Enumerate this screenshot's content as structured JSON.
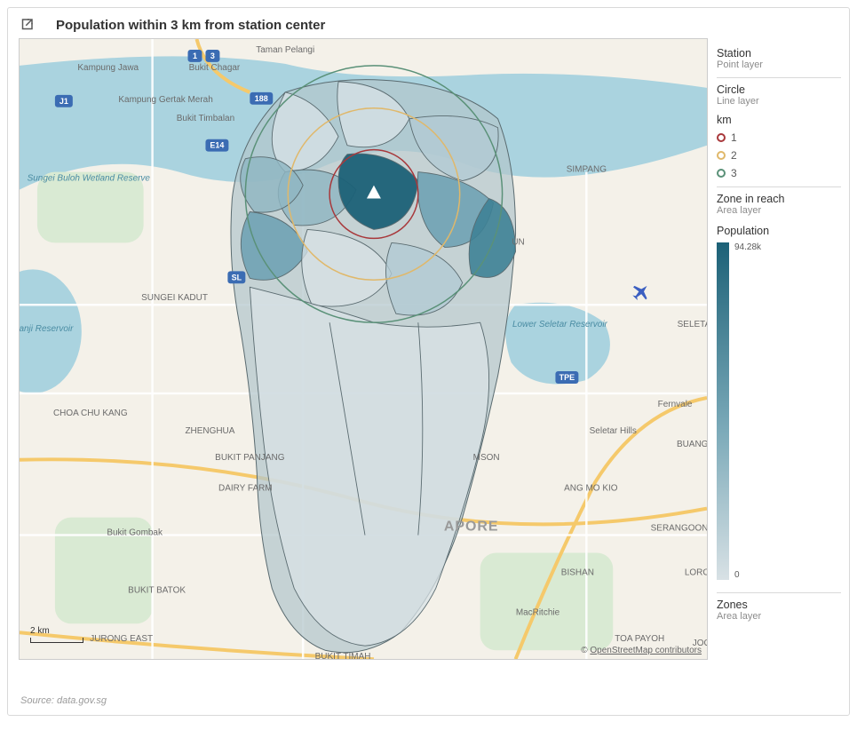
{
  "title": "Population within 3 km from station center",
  "source": "Source: data.gov.sg",
  "map": {
    "scale_label": "2 km",
    "attribution_prefix": "©",
    "attribution_link": "OpenStreetMap contributors",
    "center_label": "APORE",
    "labels": {
      "taman_pelangi": "Taman Pelangi",
      "kampung_jawa": "Kampung Jawa",
      "bukit_chagar": "Bukit Chagar",
      "kampung_gertak_merah": "Kampung Gertak Merah",
      "bukit_timbalan": "Bukit Timbalan",
      "sungei_buloh": "Sungei Buloh Wetland Reserve",
      "kranji_reservoir": "Kranji Reservoir",
      "sungei_kadut": "SUNGEI KADUT",
      "choa_chu_kang": "CHOA CHU KANG",
      "zhenghua": "ZHENGHUA",
      "bukit_panjang": "BUKIT PANJANG",
      "dairy_farm": "DAIRY FARM",
      "bukit_gombak": "Bukit Gombak",
      "bukit_batok": "BUKIT BATOK",
      "jurong_east": "JURONG EAST",
      "bukit_timah": "BUKIT TIMAH",
      "simpang": "SIMPANG",
      "lower_seletar": "Lower Seletar Reservoir",
      "seletar": "SELETAR",
      "fernvale": "Fernvale",
      "seletar_hills": "Seletar Hills",
      "buang": "BUANGK",
      "ang_mo_kio": "ANG MO KIO",
      "serangoon": "SERANGOON",
      "bishan": "BISHAN",
      "loro": "LORO",
      "joo": "JOO",
      "toa_payoh": "TOA PAYOH",
      "macritchie": "MacRitchie",
      "un": "UN",
      "mson": "MSON"
    },
    "highway": {
      "j1": "J1",
      "one": "1",
      "three": "3",
      "one88": "188",
      "e14": "E14",
      "sl": "SL",
      "tpe": "TPE"
    }
  },
  "legend": {
    "station": {
      "title": "Station",
      "sub": "Point layer"
    },
    "circle": {
      "title": "Circle",
      "sub": "Line layer"
    },
    "km_title": "km",
    "km": [
      {
        "label": "1",
        "color": "#a8383b"
      },
      {
        "label": "2",
        "color": "#e0b86a"
      },
      {
        "label": "3",
        "color": "#5a9178"
      }
    ],
    "zone_reach": {
      "title": "Zone in reach",
      "sub": "Area layer"
    },
    "population": {
      "title": "Population",
      "max": "94.28k",
      "min": "0"
    },
    "zones": {
      "title": "Zones",
      "sub": "Area layer"
    }
  }
}
